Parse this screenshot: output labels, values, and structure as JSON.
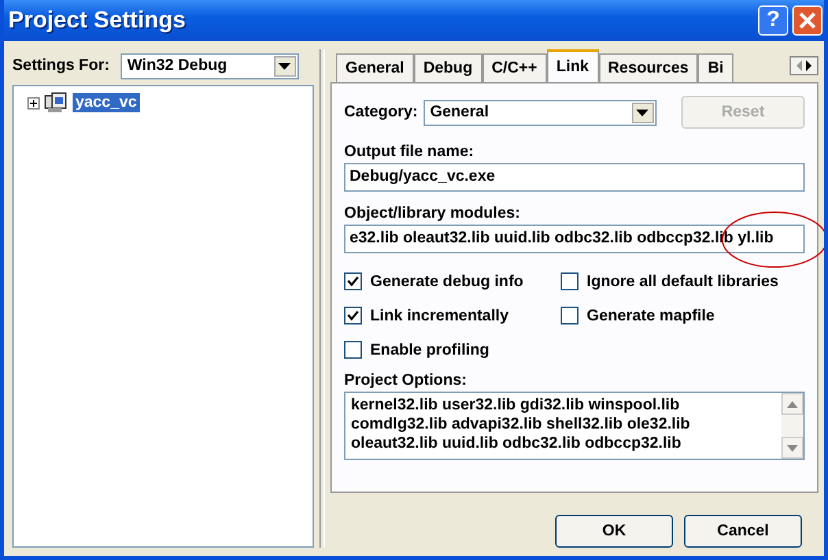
{
  "window": {
    "title": "Project Settings",
    "help": "?"
  },
  "settings_for": {
    "label": "Settings For:",
    "value": "Win32 Debug"
  },
  "tree": [
    {
      "label": "yacc_vc",
      "selected": true,
      "expanded": false
    }
  ],
  "tabs": [
    {
      "label": "General",
      "selected": false
    },
    {
      "label": "Debug",
      "selected": false
    },
    {
      "label": "C/C++",
      "selected": false
    },
    {
      "label": "Link",
      "selected": true
    },
    {
      "label": "Resources",
      "selected": false
    },
    {
      "label": "Bi",
      "selected": false
    }
  ],
  "category": {
    "label": "Category:",
    "value": "General"
  },
  "reset": {
    "label": "Reset",
    "disabled": true
  },
  "output_file": {
    "label": "Output file name:",
    "value": "Debug/yacc_vc.exe"
  },
  "modules": {
    "label": "Object/library modules:",
    "value": "e32.lib oleaut32.lib uuid.lib odbc32.lib odbccp32.lib yl.lib",
    "circled": true
  },
  "options": [
    {
      "label": "Generate debug info",
      "checked": true
    },
    {
      "label": "Ignore all default libraries",
      "checked": false
    },
    {
      "label": "Link incrementally",
      "checked": true
    },
    {
      "label": "Generate mapfile",
      "checked": false
    },
    {
      "label": "Enable profiling",
      "checked": false
    }
  ],
  "project_options": {
    "label": "Project Options:",
    "lines": [
      "kernel32.lib user32.lib gdi32.lib winspool.lib",
      "comdlg32.lib advapi32.lib shell32.lib ole32.lib",
      "oleaut32.lib uuid.lib odbc32.lib odbccp32.lib"
    ]
  },
  "buttons": [
    {
      "label": "OK"
    },
    {
      "label": "Cancel"
    }
  ]
}
